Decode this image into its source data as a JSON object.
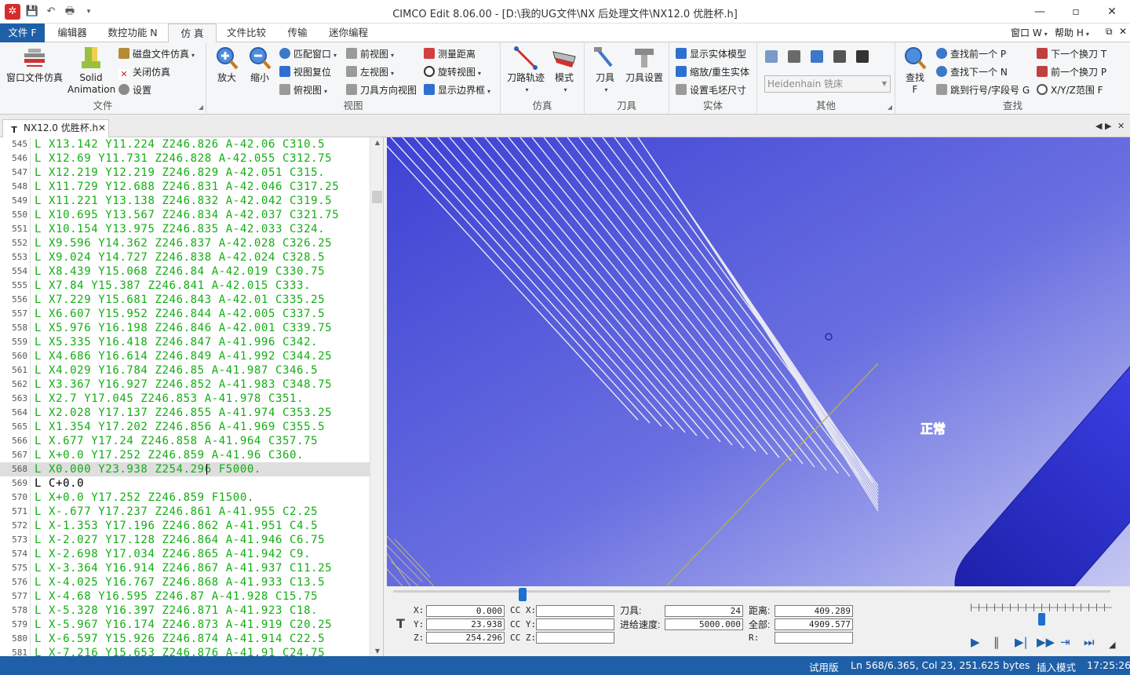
{
  "window": {
    "title": "CIMCO Edit 8.06.00 - [D:\\我的UG文件\\NX 后处理文件\\NX12.0 优胜杯.h]",
    "minimize": "—",
    "restore": "▫",
    "close": "✕"
  },
  "menu": {
    "file": "文件 F",
    "tabs": [
      "编辑器",
      "数控功能 N",
      "仿 真",
      "文件比较",
      "传输",
      "迷你编程"
    ],
    "window": "窗口 W",
    "help": "帮助 H",
    "doc_restore": "⧉",
    "doc_close": "✕"
  },
  "ribbon": {
    "file_group": {
      "label": "文件",
      "window_sim": "窗口文件仿真",
      "solid_animation": [
        "Solid",
        "Animation"
      ],
      "disk_sim": "磁盘文件仿真",
      "close_sim": "关闭仿真",
      "settings": "设置"
    },
    "view_group": {
      "label": "视图",
      "zoom_in": "放大",
      "zoom_out": "缩小",
      "fit_window": "匹配窗口",
      "reset_view": "视图复位",
      "top_view": "俯视图",
      "front_view": "前视图",
      "left_view": "左视图",
      "tool_dir_view": "刀具方向视图",
      "measure": "测量距离",
      "rotate_view": "旋转视图",
      "show_bbox": "显示边界框"
    },
    "sim_group": {
      "label": "仿真",
      "toolpath": "刀路轨迹",
      "mode": "模式"
    },
    "tool_group": {
      "label": "刀具",
      "tool": "刀具",
      "tool_settings": "刀具设置"
    },
    "solid_group": {
      "label": "实体",
      "show_solid": "显示实体模型",
      "zoom_regen": "缩放/重生实体",
      "stock_size": "设置毛坯尺寸"
    },
    "other_group": {
      "label": "其他",
      "machine": "Heidenhain 铣床"
    },
    "find_group": {
      "label": "查找",
      "find": "查找",
      "find_key": "F",
      "find_prev": "查找前一个 P",
      "find_next": "查找下一个 N",
      "jump_line": "跳到行号/字段号 G",
      "next_tool": "下一个换刀 T",
      "prev_tool": "前一个换刀 P",
      "xyz_range": "X/Y/Z范围 F"
    }
  },
  "doc_tab": {
    "name": "NX12.0 优胜杯.h",
    "close": "✕"
  },
  "editor": {
    "lines": [
      {
        "n": "545",
        "t": "L X13.142 Y11.224 Z246.826 A-42.06 C310.5"
      },
      {
        "n": "546",
        "t": "L X12.69 Y11.731 Z246.828 A-42.055 C312.75"
      },
      {
        "n": "547",
        "t": "L X12.219 Y12.219 Z246.829 A-42.051 C315."
      },
      {
        "n": "548",
        "t": "L X11.729 Y12.688 Z246.831 A-42.046 C317.25"
      },
      {
        "n": "549",
        "t": "L X11.221 Y13.138 Z246.832 A-42.042 C319.5"
      },
      {
        "n": "550",
        "t": "L X10.695 Y13.567 Z246.834 A-42.037 C321.75"
      },
      {
        "n": "551",
        "t": "L X10.154 Y13.975 Z246.835 A-42.033 C324."
      },
      {
        "n": "552",
        "t": "L X9.596 Y14.362 Z246.837 A-42.028 C326.25"
      },
      {
        "n": "553",
        "t": "L X9.024 Y14.727 Z246.838 A-42.024 C328.5"
      },
      {
        "n": "554",
        "t": "L X8.439 Y15.068 Z246.84 A-42.019 C330.75"
      },
      {
        "n": "555",
        "t": "L X7.84 Y15.387 Z246.841 A-42.015 C333."
      },
      {
        "n": "556",
        "t": "L X7.229 Y15.681 Z246.843 A-42.01 C335.25"
      },
      {
        "n": "557",
        "t": "L X6.607 Y15.952 Z246.844 A-42.005 C337.5"
      },
      {
        "n": "558",
        "t": "L X5.976 Y16.198 Z246.846 A-42.001 C339.75"
      },
      {
        "n": "559",
        "t": "L X5.335 Y16.418 Z246.847 A-41.996 C342."
      },
      {
        "n": "560",
        "t": "L X4.686 Y16.614 Z246.849 A-41.992 C344.25"
      },
      {
        "n": "561",
        "t": "L X4.029 Y16.784 Z246.85 A-41.987 C346.5"
      },
      {
        "n": "562",
        "t": "L X3.367 Y16.927 Z246.852 A-41.983 C348.75"
      },
      {
        "n": "563",
        "t": "L X2.7 Y17.045 Z246.853 A-41.978 C351."
      },
      {
        "n": "564",
        "t": "L X2.028 Y17.137 Z246.855 A-41.974 C353.25"
      },
      {
        "n": "565",
        "t": "L X1.354 Y17.202 Z246.856 A-41.969 C355.5"
      },
      {
        "n": "566",
        "t": "L X.677 Y17.24 Z246.858 A-41.964 C357.75"
      },
      {
        "n": "567",
        "t": "L X+0.0 Y17.252 Z246.859 A-41.96 C360."
      },
      {
        "n": "568",
        "t": "L X0.000 Y23.938 Z254.296 F5000."
      },
      {
        "n": "569",
        "t": "L C+0.0"
      },
      {
        "n": "570",
        "t": "L X+0.0 Y17.252 Z246.859 F1500."
      },
      {
        "n": "571",
        "t": "L X-.677 Y17.237 Z246.861 A-41.955 C2.25"
      },
      {
        "n": "572",
        "t": "L X-1.353 Y17.196 Z246.862 A-41.951 C4.5"
      },
      {
        "n": "573",
        "t": "L X-2.027 Y17.128 Z246.864 A-41.946 C6.75"
      },
      {
        "n": "574",
        "t": "L X-2.698 Y17.034 Z246.865 A-41.942 C9."
      },
      {
        "n": "575",
        "t": "L X-3.364 Y16.914 Z246.867 A-41.937 C11.25"
      },
      {
        "n": "576",
        "t": "L X-4.025 Y16.767 Z246.868 A-41.933 C13.5"
      },
      {
        "n": "577",
        "t": "L X-4.68 Y16.595 Z246.87 A-41.928 C15.75"
      },
      {
        "n": "578",
        "t": "L X-5.328 Y16.397 Z246.871 A-41.923 C18."
      },
      {
        "n": "579",
        "t": "L X-5.967 Y16.174 Z246.873 A-41.919 C20.25"
      },
      {
        "n": "580",
        "t": "L X-6.597 Y15.926 Z246.874 A-41.914 C22.5"
      },
      {
        "n": "581",
        "t": "L X-7.216 Y15.653 Z246.876 A-41.91 C24.75"
      }
    ],
    "current_line": "568"
  },
  "viewport": {
    "status_label": "正常"
  },
  "panel": {
    "x_label": "X:",
    "y_label": "Y:",
    "z_label": "Z:",
    "x": "0.000",
    "y": "23.938",
    "z": "254.296",
    "ccx_label": "CC X:",
    "ccy_label": "CC Y:",
    "ccz_label": "CC Z:",
    "ccx": "",
    "ccy": "",
    "ccz": "",
    "tool_label": "刀具:",
    "tool": "24",
    "feed_label": "进给速度:",
    "feed": "5000.000",
    "dist_label": "距离:",
    "dist": "409.289",
    "total_label": "全部:",
    "total": "4909.577",
    "r_label": "R:",
    "r": "",
    "sim_progress": 0.18,
    "speed_position": 0.5
  },
  "status": {
    "trial": "试用版",
    "position": "Ln 568/6.365, Col 23, 251.625 bytes",
    "mode": "插入模式",
    "time": "17:25:26"
  },
  "colors": {
    "accent": "#1e5fa8",
    "code_green": "#13ad13",
    "viewport_blue": "#4a4fd6",
    "tool_blue": "#2b2fc8"
  }
}
